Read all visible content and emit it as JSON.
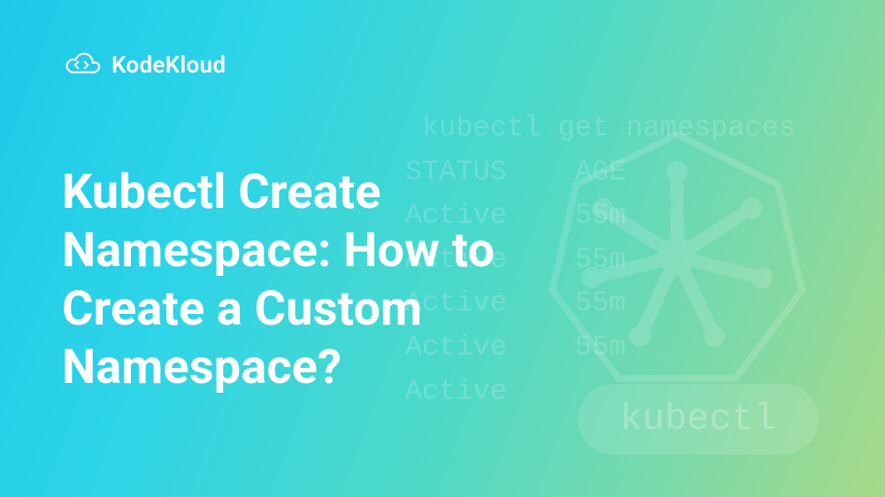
{
  "brand": {
    "name": "KodeKloud"
  },
  "hero": {
    "title": "Kubectl Create Namespace: How to Create a Custom Namespace?"
  },
  "background": {
    "terminal_text": "    kubectl get namespaces\n   STATUS    AGE\n   Active    55m\n   Active    55m\n   Active    55m\n   Active    55m\n   Active",
    "badge_text": "kubectl"
  }
}
